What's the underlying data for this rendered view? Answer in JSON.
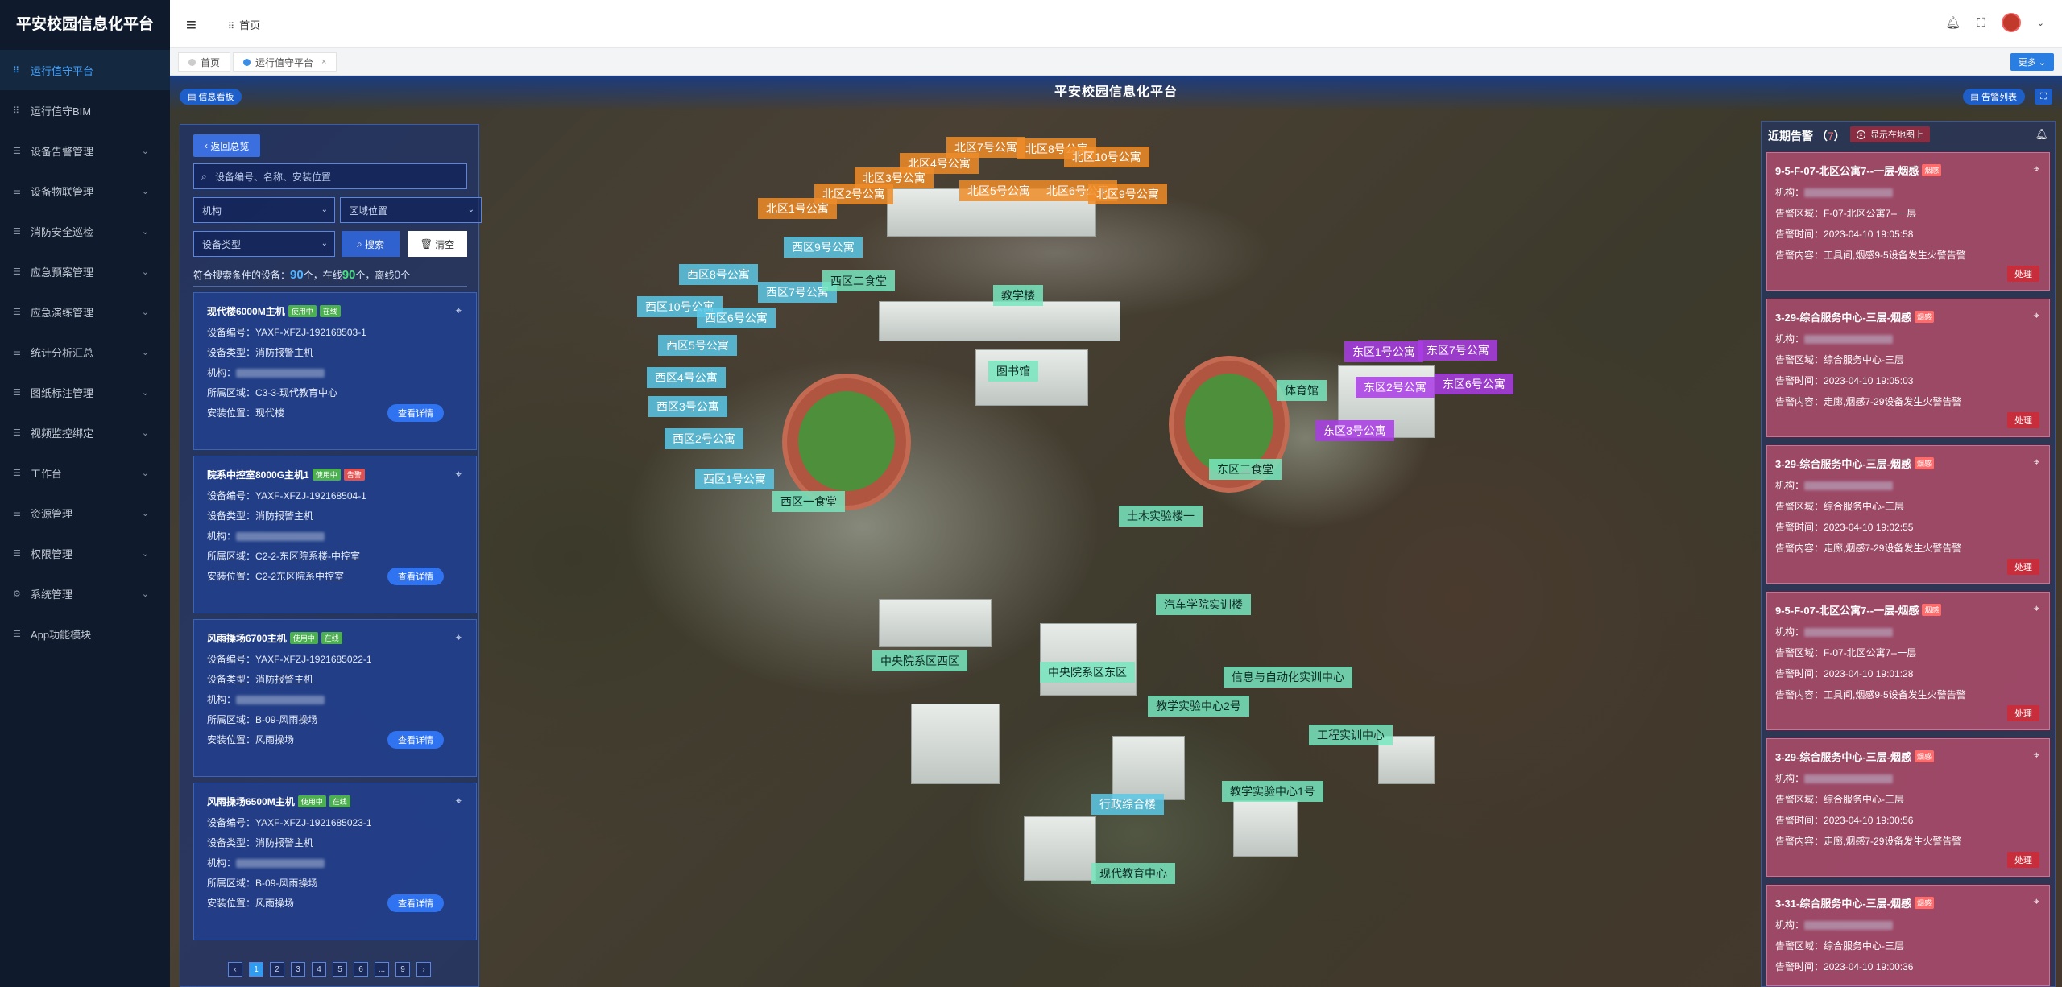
{
  "sidebar": {
    "brand": "平安校园信息化平台",
    "items": [
      {
        "label": "运行值守平台",
        "icon": "grid-icon"
      },
      {
        "label": "运行值守BIM",
        "icon": "grid-icon"
      },
      {
        "label": "设备告警管理",
        "icon": "list-icon"
      },
      {
        "label": "设备物联管理",
        "icon": "list-icon"
      },
      {
        "label": "消防安全巡检",
        "icon": "list-icon"
      },
      {
        "label": "应急预案管理",
        "icon": "list-icon"
      },
      {
        "label": "应急演练管理",
        "icon": "list-icon"
      },
      {
        "label": "统计分析汇总",
        "icon": "list-icon"
      },
      {
        "label": "图纸标注管理",
        "icon": "list-icon"
      },
      {
        "label": "视频监控绑定",
        "icon": "list-icon"
      },
      {
        "label": "工作台",
        "icon": "list-icon"
      },
      {
        "label": "资源管理",
        "icon": "list-icon"
      },
      {
        "label": "权限管理",
        "icon": "list-icon"
      },
      {
        "label": "系统管理",
        "icon": "gear-icon"
      },
      {
        "label": "App功能模块",
        "icon": "list-icon"
      }
    ]
  },
  "topbar": {
    "breadcrumb": "首页"
  },
  "tabs": {
    "home": "首页",
    "active": "运行值守平台",
    "more": "更多"
  },
  "page": {
    "title": "平安校园信息化平台",
    "info_board": "信息看板",
    "alarm_list": "告警列表"
  },
  "left_panel": {
    "back": "返回总览",
    "search_placeholder": "设备编号、名称、安装位置",
    "org_select": "机构",
    "area_select": "区域位置",
    "type_select": "设备类型",
    "search_btn": "搜索",
    "clear_btn": "清空",
    "stats": {
      "prefix": "符合搜索条件的设备：",
      "total": "90",
      "mid1": "个，在线",
      "online": "90",
      "mid2": "个，离线",
      "offline": "0",
      "suffix": "个"
    },
    "field_labels": {
      "code": "设备编号：",
      "type": "设备类型：",
      "org": "机构：",
      "area": "所属区域：",
      "install": "安装位置："
    },
    "detail_btn": "查看详情",
    "devices": [
      {
        "name": "现代楼6000M主机",
        "b1": "使用中",
        "b2": "在线",
        "code": "YAXF-XFZJ-192168503-1",
        "type": "消防报警主机",
        "area": "C3-3-现代教育中心",
        "install": "现代楼"
      },
      {
        "name": "院系中控室8000G主机1",
        "b1": "使用中",
        "b2": "告警",
        "code": "YAXF-XFZJ-192168504-1",
        "type": "消防报警主机",
        "area": "C2-2-东区院系楼-中控室",
        "install": "C2-2东区院系中控室"
      },
      {
        "name": "风雨操场6700主机",
        "b1": "使用中",
        "b2": "在线",
        "code": "YAXF-XFZJ-1921685022-1",
        "type": "消防报警主机",
        "area": "B-09-风雨操场",
        "install": "风雨操场"
      },
      {
        "name": "风雨操场6500M主机",
        "b1": "使用中",
        "b2": "在线",
        "code": "YAXF-XFZJ-1921685023-1",
        "type": "消防报警主机",
        "area": "B-09-风雨操场",
        "install": "风雨操场"
      }
    ],
    "pages": [
      "1",
      "2",
      "3",
      "4",
      "5",
      "6",
      "...",
      "9"
    ]
  },
  "map_labels": {
    "north": [
      "北区7号公寓",
      "北区8号公寓",
      "北区4号公寓",
      "北区10号公寓",
      "北区3号公寓",
      "北区2号公寓",
      "北区5号公寓",
      "北区6号公寓",
      "北区9号公寓",
      "北区1号公寓"
    ],
    "west": [
      "西区9号公寓",
      "西区8号公寓",
      "西区7号公寓",
      "西区10号公寓",
      "西区6号公寓",
      "西区5号公寓",
      "西区4号公寓",
      "西区3号公寓",
      "西区2号公寓",
      "西区1号公寓"
    ],
    "green": [
      "西区二食堂",
      "教学楼",
      "图书馆",
      "体育馆",
      "东区三食堂",
      "土木实验楼一",
      "西区一食堂",
      "汽车学院实训楼",
      "中央院系区西区",
      "中央院系区东区",
      "信息与自动化实训中心",
      "教学实验中心2号",
      "工程实训中心",
      "教学实验中心1号",
      "现代教育中心"
    ],
    "blue": [
      "行政综合楼"
    ],
    "east": [
      "东区1号公寓",
      "东区7号公寓",
      "东区2号公寓",
      "东区6号公寓",
      "东区3号公寓"
    ]
  },
  "right_panel": {
    "title": "近期告警",
    "count": "7",
    "show_on_map": "显示在地图上",
    "labels": {
      "org": "机构：",
      "area": "告警区域：",
      "time": "告警时间：",
      "content": "告警内容："
    },
    "handle": "处理",
    "alarms": [
      {
        "title": "9-5-F-07-北区公寓7--一层-烟感",
        "tag": "烟感",
        "area": "F-07-北区公寓7--一层",
        "time": "2023-04-10 19:05:58",
        "content": "工具间,烟感9-5设备发生火警告警"
      },
      {
        "title": "3-29-综合服务中心-三层-烟感",
        "tag": "烟感",
        "area": "综合服务中心-三层",
        "time": "2023-04-10 19:05:03",
        "content": "走廊,烟感7-29设备发生火警告警"
      },
      {
        "title": "3-29-综合服务中心-三层-烟感",
        "tag": "烟感",
        "area": "综合服务中心-三层",
        "time": "2023-04-10 19:02:55",
        "content": "走廊,烟感7-29设备发生火警告警"
      },
      {
        "title": "9-5-F-07-北区公寓7--一层-烟感",
        "tag": "烟感",
        "area": "F-07-北区公寓7--一层",
        "time": "2023-04-10 19:01:28",
        "content": "工具间,烟感9-5设备发生火警告警"
      },
      {
        "title": "3-29-综合服务中心-三层-烟感",
        "tag": "烟感",
        "area": "综合服务中心-三层",
        "time": "2023-04-10 19:00:56",
        "content": "走廊,烟感7-29设备发生火警告警"
      },
      {
        "title": "3-31-综合服务中心-三层-烟感",
        "tag": "烟感",
        "area": "综合服务中心-三层",
        "time": "2023-04-10 19:00:36",
        "content": ""
      }
    ]
  }
}
